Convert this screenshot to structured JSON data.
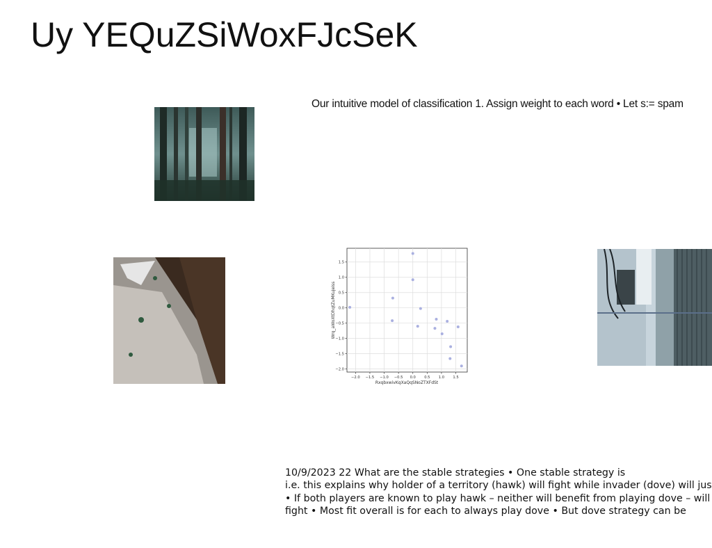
{
  "slide": {
    "title": "Uy YEQuZSiWoxFJcSeK",
    "caption": "Our intuitive model of classification 1. Assign weight to each word • Let s:= spam",
    "body_lines": [
      "10/9/2023 22 What are the stable strategies • One stable strategy is",
      "i.e. this explains why holder of a territory (hawk) will fight while invader (dove) will just",
      "• If both players are known to play hawk – neither will benefit from playing dove – will",
      "fight • Most fit overall is for each to always play dove • But dove strategy can be"
    ]
  },
  "images": {
    "forest": "forest-photo",
    "rock": "rock-foliage-photo",
    "wall": "utility-wall-photo"
  },
  "chart_data": {
    "type": "scatter",
    "xlabel": "RxqbxwivKqXaQqSNoZTXFdSt",
    "ylabel": "Wrq_aWoXtDhqtZuMKujeiss",
    "xlim": [
      -2.3,
      1.9
    ],
    "ylim": [
      -2.1,
      1.95
    ],
    "xticks": [
      "−2.0",
      "−1.5",
      "−1.0",
      "−0.5",
      "0.0",
      "0.5",
      "1.0",
      "1.5"
    ],
    "xtick_values": [
      -2.0,
      -1.5,
      -1.0,
      -0.5,
      0.0,
      0.5,
      1.0,
      1.5
    ],
    "yticks": [
      "−2.0",
      "−1.5",
      "−1.0",
      "−0.5",
      "0.0",
      "0.5",
      "1.0",
      "1.5"
    ],
    "ytick_values": [
      -2.0,
      -1.5,
      -1.0,
      -0.5,
      0.0,
      0.5,
      1.0,
      1.5
    ],
    "grid": true,
    "point_color": "#aab0e0",
    "points": [
      {
        "x": -2.2,
        "y": 0.02
      },
      {
        "x": -0.7,
        "y": 0.32
      },
      {
        "x": -0.72,
        "y": -0.42
      },
      {
        "x": 0.0,
        "y": 1.78
      },
      {
        "x": 0.0,
        "y": 0.92
      },
      {
        "x": 0.27,
        "y": -0.02
      },
      {
        "x": 0.17,
        "y": -0.6
      },
      {
        "x": 0.77,
        "y": -0.67
      },
      {
        "x": 0.82,
        "y": -0.37
      },
      {
        "x": 1.02,
        "y": -0.85
      },
      {
        "x": 1.2,
        "y": -0.44
      },
      {
        "x": 1.32,
        "y": -1.27
      },
      {
        "x": 1.3,
        "y": -1.66
      },
      {
        "x": 1.58,
        "y": -0.62
      },
      {
        "x": 1.7,
        "y": -1.9
      }
    ]
  }
}
